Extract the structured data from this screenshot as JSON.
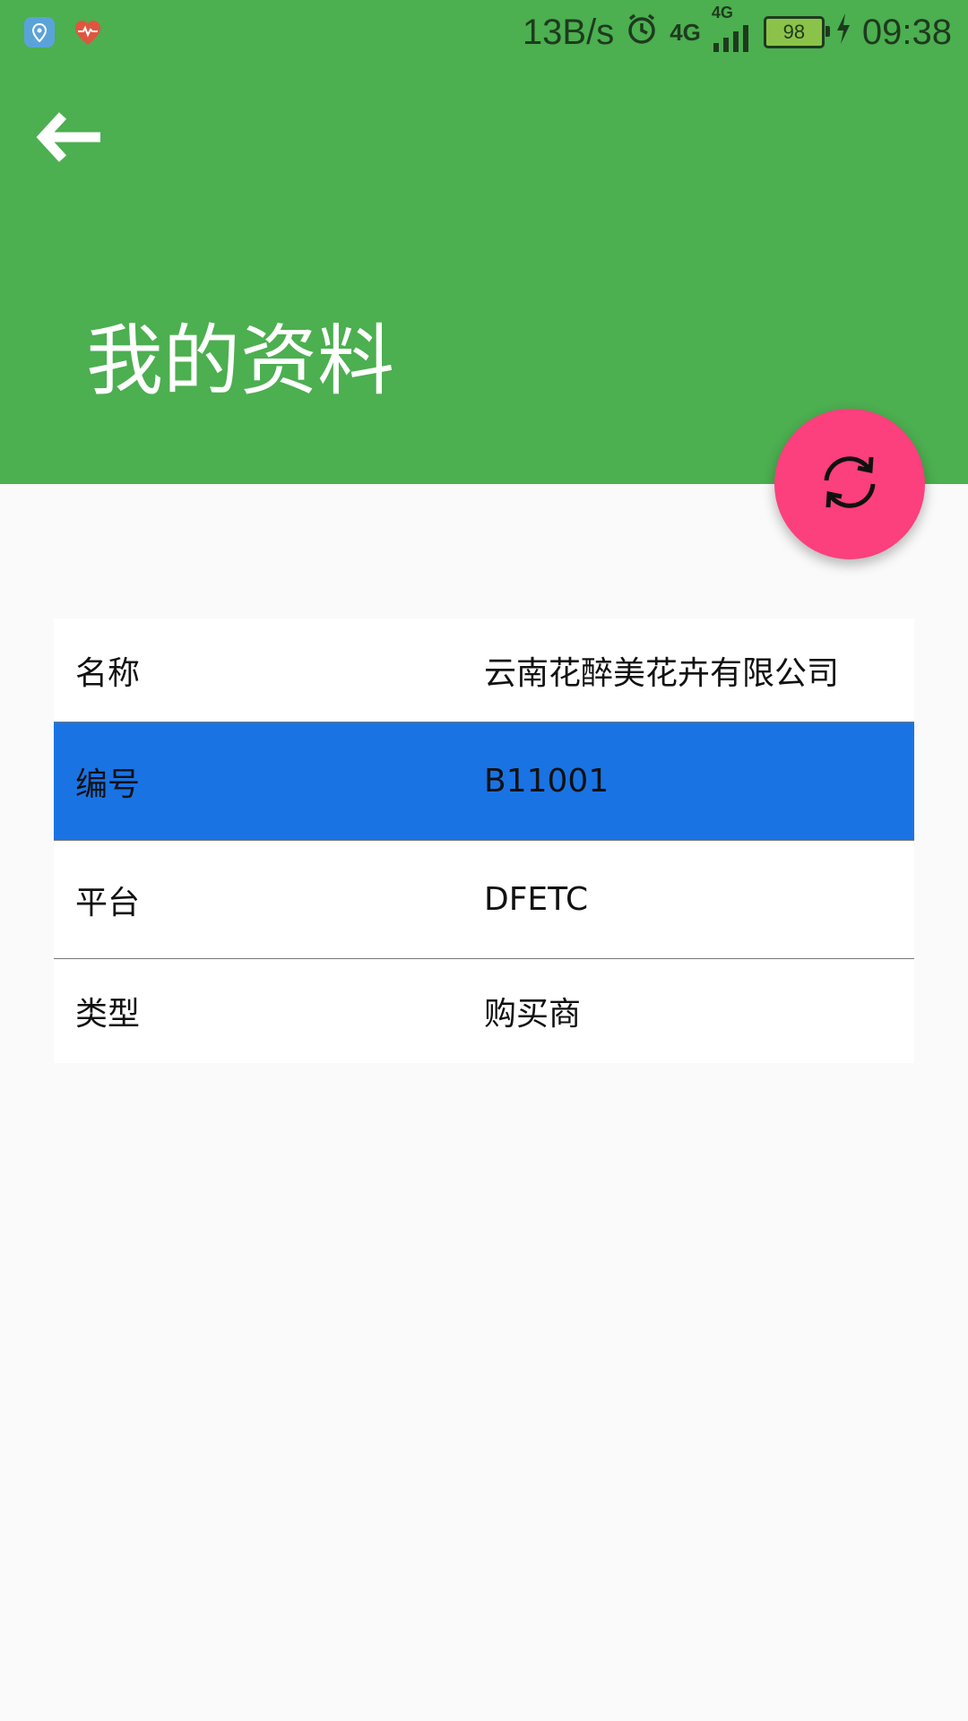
{
  "status_bar": {
    "net_speed": "13B/s",
    "network_a": "4G",
    "network_b": "4G",
    "battery": "98",
    "time": "09:38",
    "icons": [
      "location-app-icon",
      "health-app-icon",
      "alarm-icon",
      "signal-icon",
      "charging-icon"
    ]
  },
  "header": {
    "title": "我的资料",
    "back_icon": "arrow-left-icon",
    "color": "#4caf50"
  },
  "fab": {
    "icon": "refresh-icon",
    "color": "#fc3f7d"
  },
  "profile": {
    "rows": [
      {
        "label": "名称",
        "value": "云南花醉美花卉有限公司"
      },
      {
        "label": "编号",
        "value": "B11001"
      },
      {
        "label": "平台",
        "value": "DFETC"
      },
      {
        "label": "类型",
        "value": "购买商"
      }
    ],
    "selected_index": 1,
    "selected_color": "#1a73e3"
  }
}
